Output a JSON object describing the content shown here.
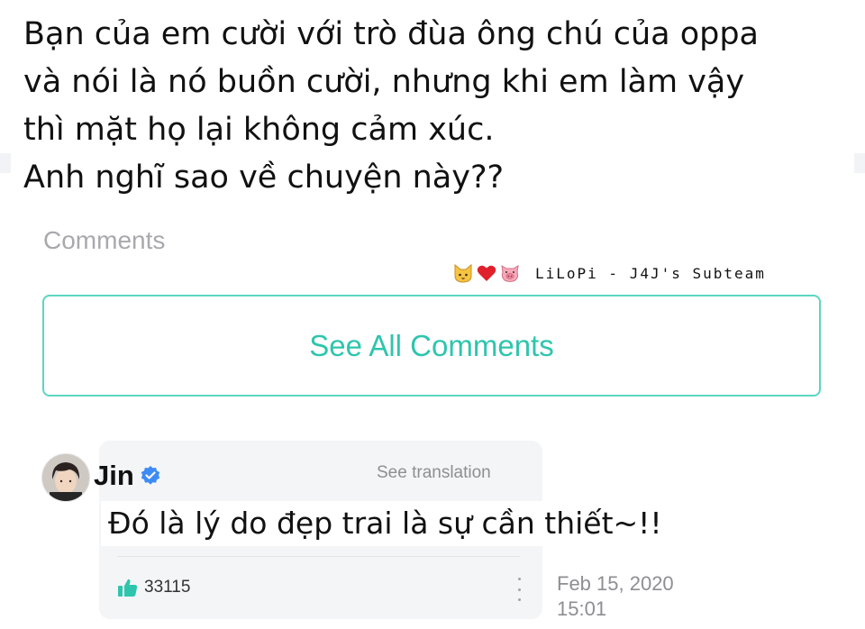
{
  "question": {
    "lines": [
      "Bạn của em cười với trò đùa ông chú của oppa",
      "và nói là nó buồn cười, nhưng khi em làm vậy",
      "thì mặt họ lại không cảm xúc.",
      "Anh nghĩ sao về chuyện này??"
    ]
  },
  "comments": {
    "label": "Comments",
    "see_all_label": "See All Comments"
  },
  "watermark": {
    "text": "LiLoPi - J4J's Subteam",
    "icons": [
      "cat-face-icon",
      "red-heart-icon",
      "pig-face-icon"
    ]
  },
  "reply": {
    "author": "Jin",
    "verified_icon": "verified-badge-icon",
    "translate_label": "See translation",
    "text": "Đó là lý do đẹp trai là sự cần thiết~!!",
    "likes": "33115",
    "date": "Feb 15, 2020",
    "time": "15:01"
  },
  "colors": {
    "accent": "#2fc5ad",
    "accent_border": "#5cd5c2",
    "verified": "#3d8bf5",
    "like": "#2fc5ad",
    "muted_text": "#8e8e93",
    "card_bg": "#f4f5f7"
  }
}
